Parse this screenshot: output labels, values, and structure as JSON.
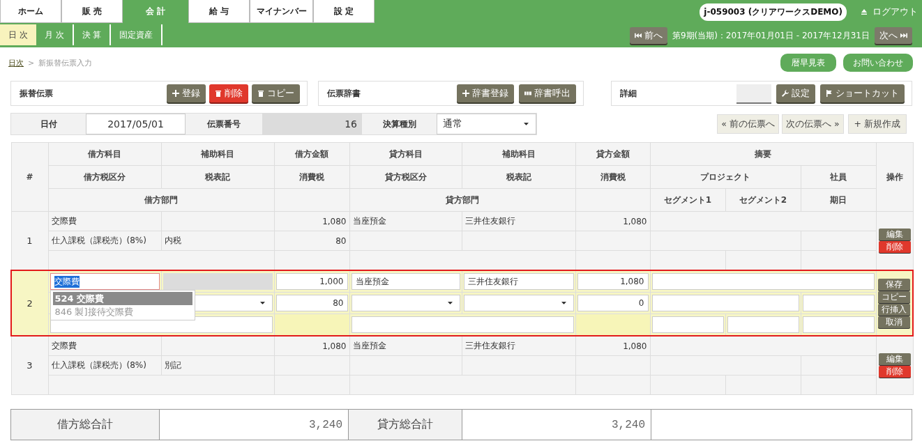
{
  "top_tabs": [
    {
      "label": "ホーム",
      "selected": false
    },
    {
      "label": "販 売",
      "selected": false
    },
    {
      "label": "会 計",
      "selected": true
    },
    {
      "label": "給 与",
      "selected": false
    },
    {
      "label": "マイナンバー",
      "selected": false
    },
    {
      "label": "設 定",
      "selected": false
    }
  ],
  "sub_tabs": [
    {
      "label": "日 次",
      "selected": true
    },
    {
      "label": "月 次",
      "selected": false
    },
    {
      "label": "決 算",
      "selected": false
    },
    {
      "label": "固定資産",
      "selected": false
    }
  ],
  "user": "j-059003 (クリアワークスDEMO)",
  "logout": "ログアウト",
  "period": {
    "prev": "前へ",
    "text": "第9期(当期)：2017年01月01日 - 2017年12月31日",
    "next": "次へ"
  },
  "breadcrumb": {
    "link": "日次",
    "separator": ">",
    "current": "新振替伝票入力"
  },
  "header_buttons": [
    "暦早見表",
    "お問い合わせ"
  ],
  "panels": [
    {
      "title": "振替伝票",
      "buttons": [
        {
          "label": "登録",
          "kind": "add"
        },
        {
          "label": "削除",
          "kind": "delete"
        },
        {
          "label": "コピー",
          "kind": "copy"
        }
      ]
    },
    {
      "title": "伝票辞書",
      "buttons": [
        {
          "label": "辞書登録",
          "kind": "add"
        },
        {
          "label": "辞書呼出",
          "kind": "open"
        }
      ]
    },
    {
      "title": "詳細",
      "buttons": [
        {
          "kind": "blank"
        },
        {
          "label": "設定",
          "kind": "settings"
        },
        {
          "label": "ショートカット",
          "kind": "shortcut"
        }
      ]
    }
  ],
  "voucher_fields": [
    {
      "label": "日付",
      "value": "2017/05/01",
      "kind": "input"
    },
    {
      "label": "伝票番号",
      "value": "16",
      "kind": "readonly"
    },
    {
      "label": "決算種別",
      "value": "通常",
      "kind": "select"
    }
  ],
  "voucher_nav": [
    "« 前の伝票へ",
    "次の伝票へ »",
    "+ 新規作成"
  ],
  "columns": {
    "no": "#",
    "actions": "操作",
    "row1": [
      "借方科目",
      "補助科目",
      "借方金額",
      "貸方科目",
      "補助科目",
      "貸方金額",
      "摘要"
    ],
    "row2": [
      "借方税区分",
      "税表記",
      "消費税",
      "貸方税区分",
      "税表記",
      "消費税",
      "プロジェクト",
      "社員"
    ],
    "row3": [
      "借方部門",
      "貸方部門",
      "セグメント1",
      "セグメント2",
      "期日"
    ]
  },
  "rows": [
    {
      "no": "1",
      "editing": false,
      "debit_account": "交際費",
      "debit_amount": "1,080",
      "credit_account": "当座預金",
      "credit_sub": "三井住友銀行",
      "credit_amount": "1,080",
      "debit_tax_class": "仕入課税（課税売）(8%)",
      "debit_tax_note": "内税",
      "debit_tax": "80",
      "actions": [
        {
          "label": "編集",
          "kind": "edit"
        },
        {
          "label": "削除",
          "kind": "delete"
        }
      ]
    },
    {
      "no": "2",
      "editing": true,
      "debit_account": "交際費",
      "text_selected": true,
      "debit_sub_disabled": true,
      "debit_amount": "1,000",
      "credit_account": "当座預金",
      "credit_sub": "三井住友銀行",
      "credit_amount": "1,080",
      "debit_tax": "80",
      "credit_tax": "0",
      "suggestions": [
        {
          "code": "524",
          "name": "交際費",
          "selected": true
        },
        {
          "code": "846",
          "name": "製]接待交際費",
          "selected": false
        }
      ],
      "actions": [
        {
          "label": "保存",
          "kind": "edit"
        },
        {
          "label": "コピー",
          "kind": "edit"
        },
        {
          "label": "行挿入",
          "kind": "edit"
        },
        {
          "label": "取消",
          "kind": "edit"
        }
      ]
    },
    {
      "no": "3",
      "editing": false,
      "debit_account": "交際費",
      "debit_amount": "1,080",
      "credit_account": "当座預金",
      "credit_sub": "三井住友銀行",
      "credit_amount": "1,080",
      "debit_tax_class": "仕入課税（課税売）(8%)",
      "debit_tax_note": "別記",
      "actions": [
        {
          "label": "編集",
          "kind": "edit"
        },
        {
          "label": "削除",
          "kind": "delete"
        }
      ]
    }
  ],
  "totals": {
    "debit_label": "借方総合計",
    "debit": "3,240",
    "credit_label": "貸方総合計",
    "credit": "3,240"
  }
}
